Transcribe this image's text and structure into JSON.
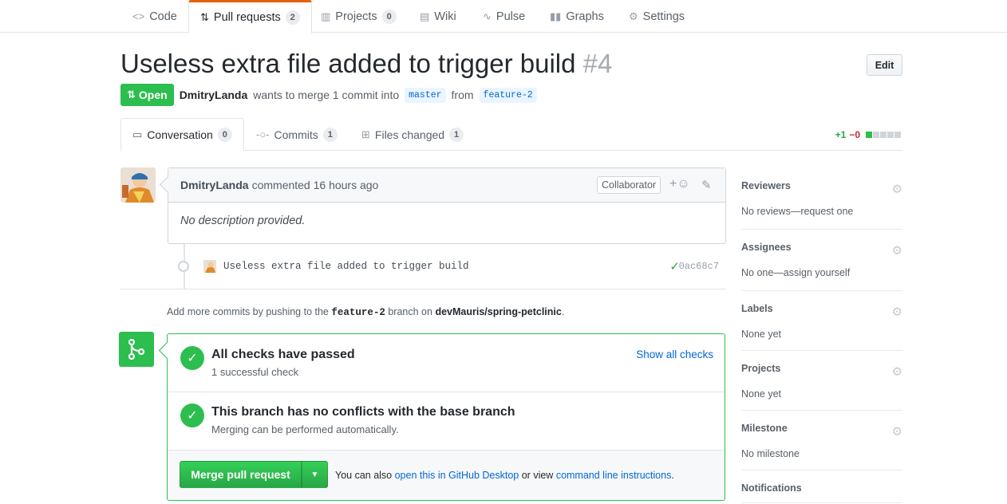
{
  "repo_nav": {
    "tabs": [
      {
        "icon": "code-icon",
        "label": "Code"
      },
      {
        "icon": "git-pull-request-icon",
        "label": "Pull requests",
        "count": "2"
      },
      {
        "icon": "project-icon",
        "label": "Projects",
        "count": "0"
      },
      {
        "icon": "book-icon",
        "label": "Wiki"
      },
      {
        "icon": "pulse-icon",
        "label": "Pulse"
      },
      {
        "icon": "graph-icon",
        "label": "Graphs"
      },
      {
        "icon": "gear-icon",
        "label": "Settings"
      }
    ],
    "selected": "Pull requests",
    "accent_color": "#e36209"
  },
  "pr": {
    "title": "Useless extra file added to trigger build",
    "number": "#4",
    "edit_label": "Edit",
    "state": "Open",
    "state_color": "#2cbe4e",
    "author": "DmitryLanda",
    "meta_text": "wants to merge 1 commit into",
    "base_branch": "master",
    "from_text": "from",
    "head_branch": "feature-2"
  },
  "pr_tabs": [
    {
      "icon": "comment-discussion-icon",
      "label": "Conversation",
      "count": "0"
    },
    {
      "icon": "git-commit-icon",
      "label": "Commits",
      "count": "1"
    },
    {
      "icon": "file-diff-icon",
      "label": "Files changed",
      "count": "1"
    }
  ],
  "diffstat": {
    "additions": "+1",
    "deletions": "−0",
    "green_blocks": 1,
    "total_blocks": 5
  },
  "comment": {
    "author": "DmitryLanda",
    "action": "commented 16 hours ago",
    "badge": "Collaborator",
    "react_label": "+☺",
    "body": "No description provided."
  },
  "commit": {
    "message": "Useless extra file added to trigger build",
    "sha": "0ac68c7"
  },
  "push_hint": {
    "prefix": "Add more commits by pushing to the",
    "branch": "feature-2",
    "middle": "branch on",
    "repo": "devMauris/spring-petclinic",
    "suffix": "."
  },
  "merge": {
    "checks_title": "All checks have passed",
    "checks_sub": "1 successful check",
    "show_all": "Show all checks",
    "conflicts_title": "This branch has no conflicts with the base branch",
    "conflicts_sub": "Merging can be performed automatically.",
    "merge_button": "Merge pull request",
    "alt_prefix": "You can also",
    "alt_link1": "open this in GitHub Desktop",
    "alt_middle": "or view",
    "alt_link2": "command line instructions",
    "alt_suffix": "."
  },
  "sidebar": [
    {
      "heading": "Reviewers",
      "value": "No reviews—request one"
    },
    {
      "heading": "Assignees",
      "value": "No one—assign yourself"
    },
    {
      "heading": "Labels",
      "value": "None yet"
    },
    {
      "heading": "Projects",
      "value": "None yet"
    },
    {
      "heading": "Milestone",
      "value": "No milestone"
    },
    {
      "heading": "Notifications",
      "value": ""
    }
  ]
}
